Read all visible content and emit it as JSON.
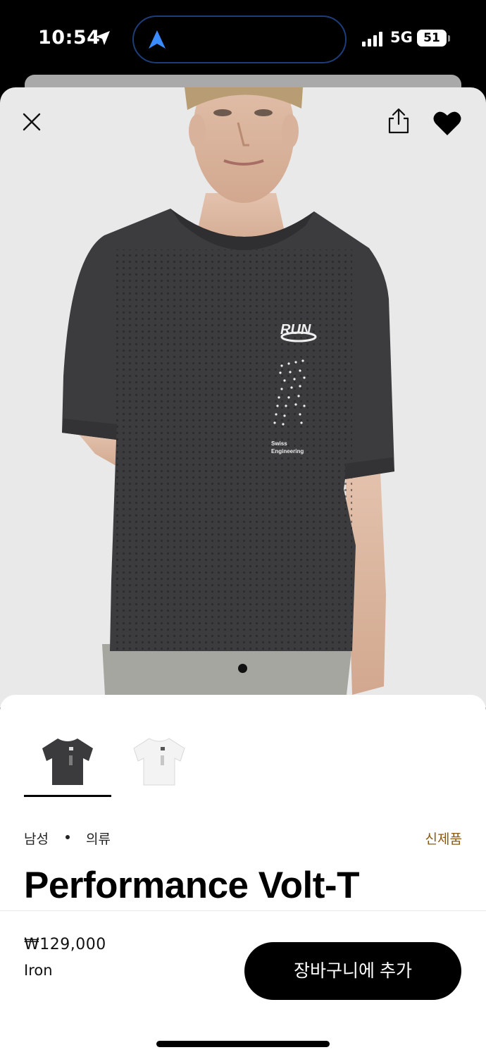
{
  "status_bar": {
    "time": "10:54",
    "network": "5G",
    "battery": "51"
  },
  "product": {
    "title": "Performance Volt-T",
    "breadcrumb": [
      "남성",
      "의류"
    ],
    "badge": "신제품",
    "price": "₩129,000",
    "color": "Iron",
    "print_logo": "RUN",
    "print_text_line1": "Swiss",
    "print_text_line2": "Engineering",
    "variants": [
      {
        "name": "Iron",
        "color": "#3b3b3d",
        "selected": true
      },
      {
        "name": "White",
        "color": "#f2f2f2",
        "selected": false
      }
    ]
  },
  "actions": {
    "add_to_cart": "장바구니에 추가"
  },
  "icons": [
    "location-arrow-icon",
    "navigation-arrow-icon",
    "signal-icon",
    "battery-icon",
    "close-icon",
    "share-icon",
    "heart-icon"
  ],
  "colors": {
    "accent_badge": "#8a5a13",
    "hero_bg": "#e9e9ea",
    "shirt": "#3c3c3e",
    "button": "#000000"
  }
}
